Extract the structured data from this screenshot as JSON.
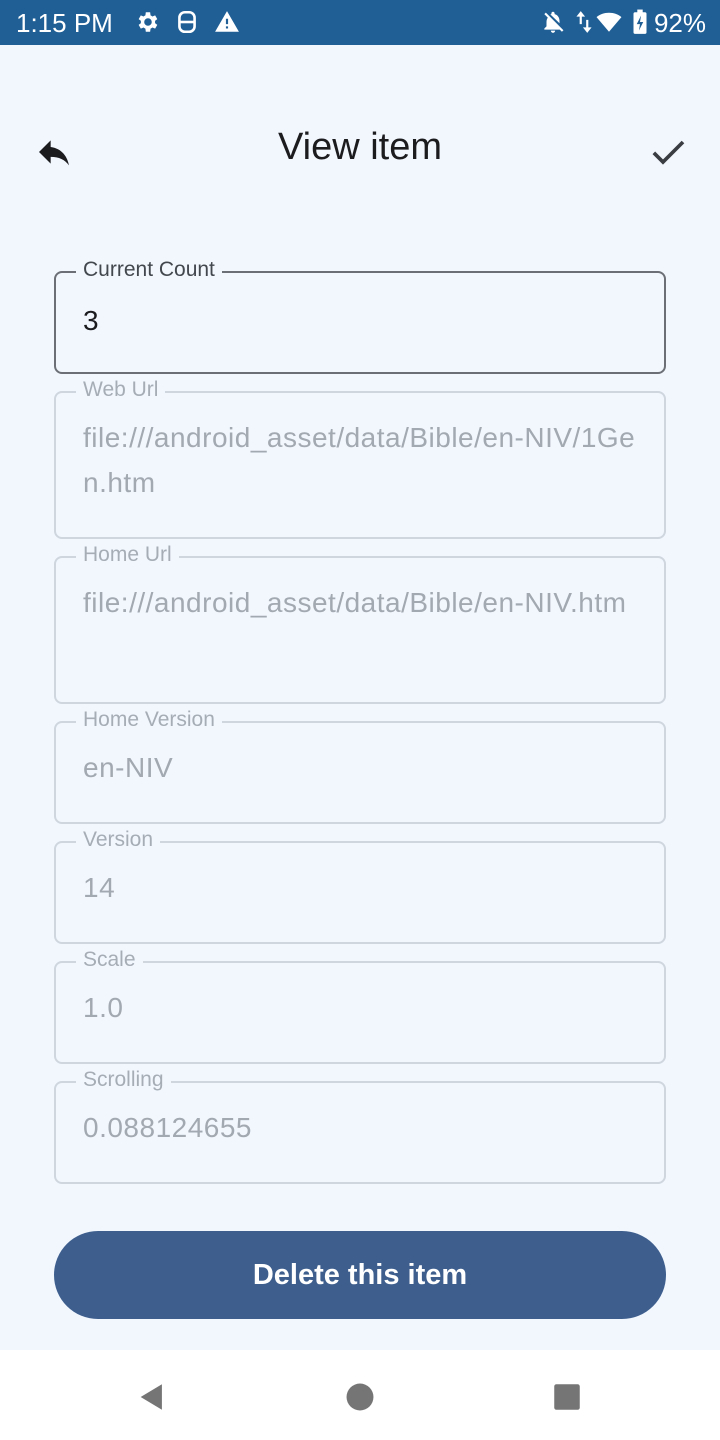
{
  "status_bar": {
    "time": "1:15 PM",
    "icons": [
      "gear-icon",
      "sim-icon",
      "warning-icon",
      "bell-off-icon",
      "data-arrows-icon",
      "wifi-icon",
      "battery-icon"
    ],
    "battery": "92%"
  },
  "header": {
    "title": "View item",
    "back_icon": "reply-arrow-icon",
    "confirm_icon": "checkmark-icon"
  },
  "fields": [
    {
      "label": "Current Count",
      "value": "3",
      "editable": true
    },
    {
      "label": "Web Url",
      "value": "file:///android_asset/data/Bible/en-NIV/1Gen.htm",
      "editable": false
    },
    {
      "label": "Home Url",
      "value": "file:///android_asset/data/Bible/en-NIV.htm",
      "editable": false
    },
    {
      "label": "Home Version",
      "value": "en-NIV",
      "editable": false
    },
    {
      "label": "Version",
      "value": "14",
      "editable": false
    },
    {
      "label": "Scale",
      "value": "1.0",
      "editable": false
    },
    {
      "label": "Scrolling",
      "value": "0.088124655",
      "editable": false
    }
  ],
  "actions": {
    "delete_label": "Delete this item"
  },
  "colors": {
    "status_bar": "#1f5f96",
    "background": "#f2f7fe",
    "primary_button": "#3e5f8e"
  },
  "nav_bar": {
    "buttons": [
      "back-triangle-icon",
      "home-circle-icon",
      "recents-square-icon"
    ]
  }
}
